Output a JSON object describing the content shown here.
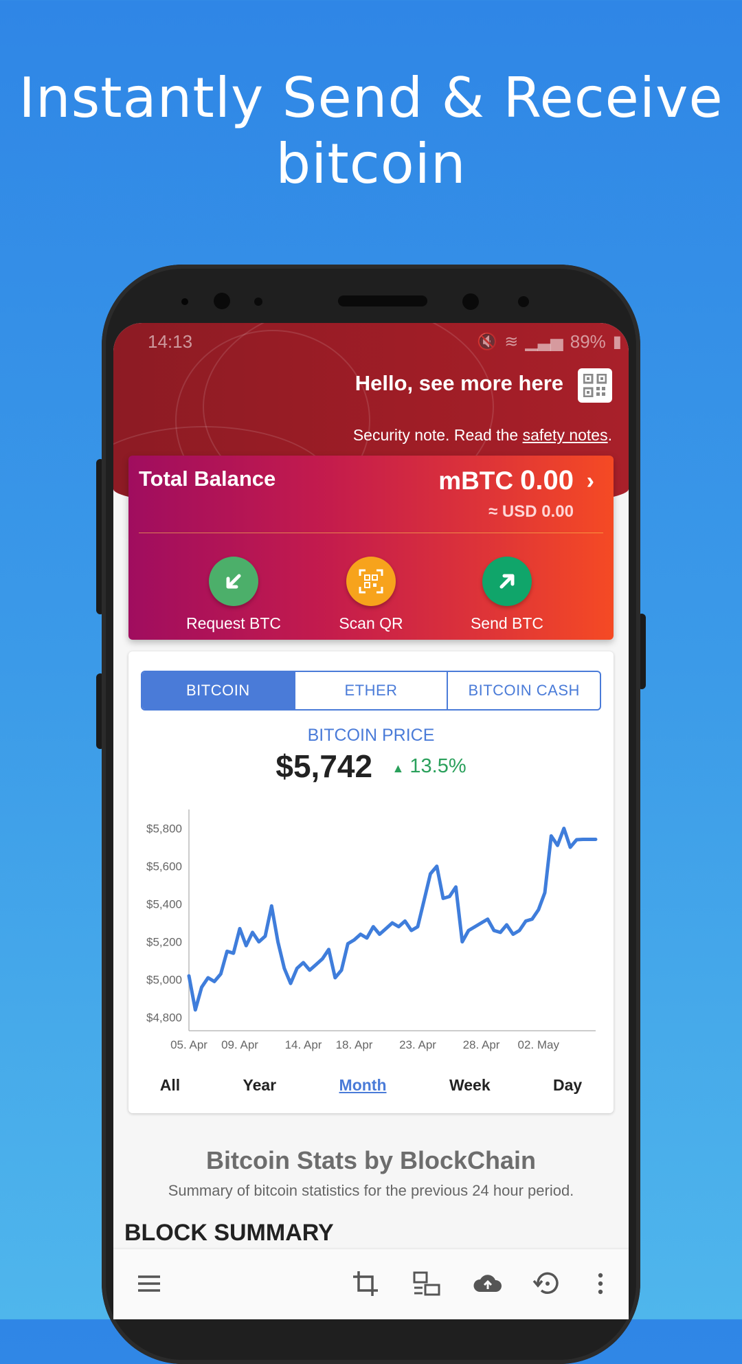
{
  "headline": {
    "line1": "Instantly Send & Receive",
    "line2": "bitcoin"
  },
  "status_bar": {
    "time": "14:13",
    "battery": "89%"
  },
  "header": {
    "greeting": "Hello, see more here",
    "security_prefix": "Security note. Read the ",
    "security_link": "safety notes",
    "security_suffix": "."
  },
  "balance": {
    "label": "Total Balance",
    "unit": "mBTC",
    "amount": "0.00",
    "usd_prefix": "≈ USD",
    "usd_amount": "0.00"
  },
  "actions": [
    {
      "label": "Request BTC",
      "icon": "arrow-down-left-icon",
      "color": "#4caf6a"
    },
    {
      "label": "Scan QR",
      "icon": "qr-scan-icon",
      "color": "#f7a31c"
    },
    {
      "label": "Send BTC",
      "icon": "arrow-up-right-icon",
      "color": "#10a56a"
    }
  ],
  "tabs": [
    {
      "label": "BITCOIN",
      "active": true
    },
    {
      "label": "ETHER",
      "active": false
    },
    {
      "label": "BITCOIN CASH",
      "active": false
    }
  ],
  "price": {
    "title": "BITCOIN PRICE",
    "value": "$5,742",
    "change": "13.5%",
    "direction": "up"
  },
  "ranges": [
    {
      "label": "All",
      "active": false
    },
    {
      "label": "Year",
      "active": false
    },
    {
      "label": "Month",
      "active": true
    },
    {
      "label": "Week",
      "active": false
    },
    {
      "label": "Day",
      "active": false
    }
  ],
  "stats": {
    "title": "Bitcoin Stats by BlockChain",
    "subtitle": "Summary of bitcoin statistics for the previous 24 hour period.",
    "section": "BLOCK SUMMARY"
  },
  "colors": {
    "accent": "#4a7bd8",
    "up": "#2aa05b",
    "header_red": "#9f1d26"
  },
  "bottom_bar_icons": [
    "menu-icon",
    "crop-icon",
    "devices-icon",
    "cloud-upload-icon",
    "restore-icon",
    "more-vert-icon"
  ],
  "chart_data": {
    "type": "line",
    "series": [
      {
        "name": "",
        "x_days": [
          0,
          0.5,
          1,
          1.5,
          2,
          2.5,
          3,
          3.5,
          4,
          4.5,
          5,
          5.5,
          6,
          6.5,
          7,
          7.5,
          8,
          8.5,
          9,
          9.5,
          10,
          10.5,
          11,
          11.5,
          12,
          12.5,
          13,
          13.5,
          14,
          14.5,
          15,
          15.5,
          16,
          16.5,
          17,
          17.5,
          18,
          18.5,
          19,
          19.5,
          20,
          20.5,
          21,
          21.5,
          22,
          22.5,
          23,
          23.5,
          24,
          24.5,
          25,
          25.5,
          26,
          26.5,
          27,
          27.5,
          28,
          28.5,
          29,
          29.5,
          30,
          30.5,
          31,
          31.5,
          32
        ],
        "values": [
          5020,
          4840,
          4960,
          5010,
          4990,
          5030,
          5150,
          5140,
          5270,
          5180,
          5250,
          5200,
          5230,
          5390,
          5200,
          5060,
          4980,
          5060,
          5090,
          5050,
          5080,
          5110,
          5160,
          5010,
          5050,
          5190,
          5210,
          5240,
          5220,
          5280,
          5240,
          5270,
          5300,
          5280,
          5310,
          5260,
          5280,
          5420,
          5560,
          5600,
          5430,
          5440,
          5490,
          5200,
          5260,
          5280,
          5300,
          5320,
          5260,
          5250,
          5290,
          5240,
          5260,
          5310,
          5320,
          5370,
          5460,
          5760,
          5710,
          5800,
          5700,
          5740,
          5742,
          5742,
          5742
        ]
      }
    ],
    "x_tick_labels": [
      "05. Apr",
      "09. Apr",
      "14. Apr",
      "18. Apr",
      "23. Apr",
      "28. Apr",
      "02. May"
    ],
    "x_tick_days": [
      0,
      4,
      9,
      13,
      18,
      23,
      27.5
    ],
    "y_tick_labels": [
      "$5,800",
      "$5,600",
      "$5,400",
      "$5,200",
      "$5,000",
      "$4,800"
    ],
    "y_ticks": [
      5800,
      5600,
      5400,
      5200,
      5000,
      4800
    ],
    "ylim": [
      4730,
      5900
    ],
    "xlim": [
      0,
      32
    ],
    "grid": false,
    "line_color": "#3f7ddb"
  }
}
